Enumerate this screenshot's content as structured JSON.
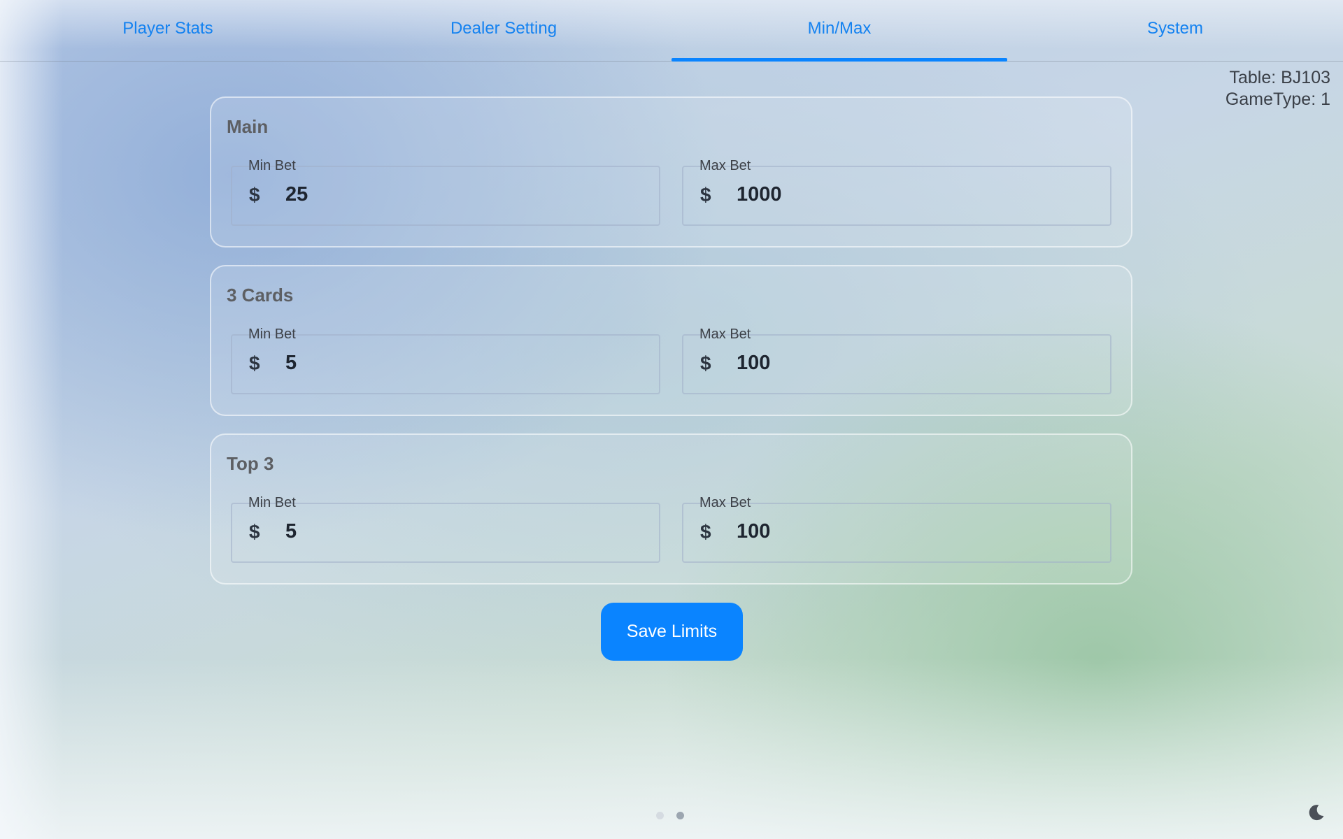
{
  "tabs": [
    {
      "label": "Player Stats",
      "active": false
    },
    {
      "label": "Dealer Setting",
      "active": false
    },
    {
      "label": "Min/Max",
      "active": true
    },
    {
      "label": "System",
      "active": false
    }
  ],
  "table_info": {
    "table": "Table: BJ103",
    "game_type": "GameType: 1"
  },
  "sections": [
    {
      "title": "Main",
      "min": {
        "label": "Min Bet",
        "currency": "$",
        "value": "25"
      },
      "max": {
        "label": "Max Bet",
        "currency": "$",
        "value": "1000"
      }
    },
    {
      "title": "3 Cards",
      "min": {
        "label": "Min Bet",
        "currency": "$",
        "value": "5"
      },
      "max": {
        "label": "Max Bet",
        "currency": "$",
        "value": "100"
      }
    },
    {
      "title": "Top 3",
      "min": {
        "label": "Min Bet",
        "currency": "$",
        "value": "5"
      },
      "max": {
        "label": "Max Bet",
        "currency": "$",
        "value": "100"
      }
    }
  ],
  "save_button": {
    "label": "Save Limits"
  },
  "pager": {
    "count": 2,
    "active_index": 1
  },
  "icons": {
    "theme_toggle": "moon-icon"
  },
  "colors": {
    "accent": "#0a84ff",
    "tab_text": "#1482f0"
  }
}
